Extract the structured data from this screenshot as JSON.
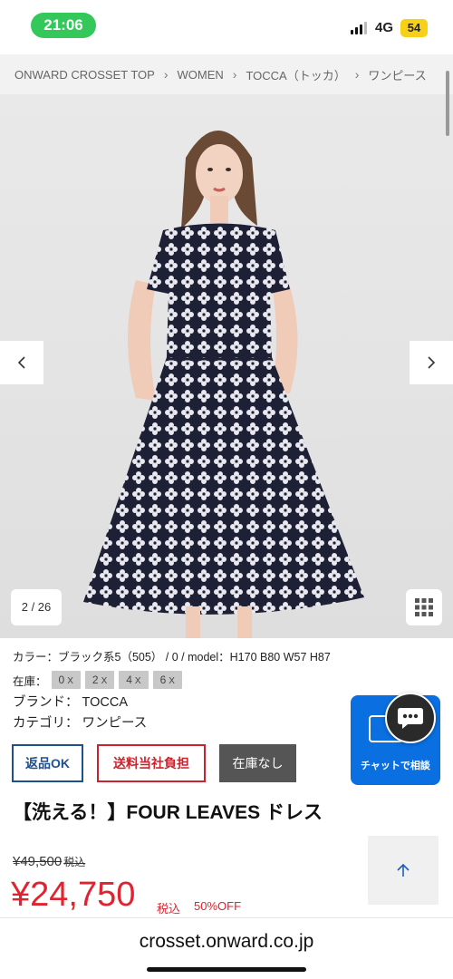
{
  "status": {
    "time": "21:06",
    "network": "4G",
    "battery": "54"
  },
  "breadcrumb": [
    "ONWARD CROSSET TOP",
    "WOMEN",
    "TOCCA（トッカ）",
    "ワンピース"
  ],
  "gallery": {
    "counter": "2 / 26"
  },
  "product": {
    "info_line": "カラー：ブラック系5（505）  /  0  /  model：H170 B80 W57 H87",
    "stock_label": "在庫：",
    "stock": [
      {
        "size": "0",
        "mark": "X"
      },
      {
        "size": "2",
        "mark": "X"
      },
      {
        "size": "4",
        "mark": "X"
      },
      {
        "size": "6",
        "mark": "X"
      }
    ],
    "brand_row": "ブランド： TOCCA",
    "category_row": "カテゴリ： ワンピース",
    "tags": {
      "returns": "返品OK",
      "shipping": "送料当社負担",
      "stock": "在庫なし"
    },
    "title": "【洗える！】FOUR LEAVES ドレス",
    "original_price": "¥49,500",
    "original_tax": "税込",
    "sale_price": "¥24,750",
    "sale_tax": "税込",
    "discount": "50%OFF"
  },
  "chat": {
    "label": "チャットで相談"
  },
  "browser": {
    "url": "crosset.onward.co.jp"
  },
  "colors": {
    "sale_red": "#e0232f",
    "returns_blue": "#1f4f8c",
    "chat_blue": "#0a6fe0",
    "status_green": "#34c759"
  }
}
